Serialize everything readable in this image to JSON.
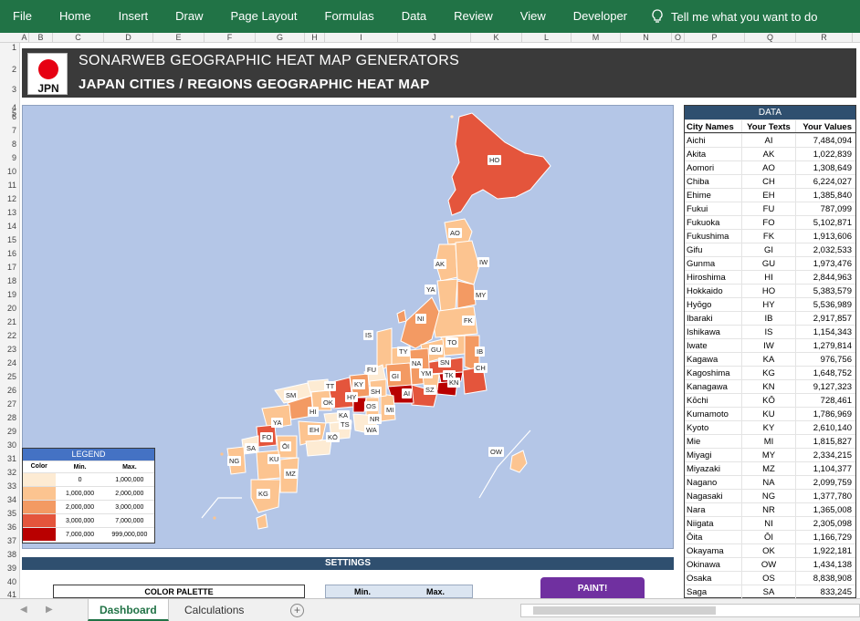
{
  "ribbon": {
    "tabs": [
      "File",
      "Home",
      "Insert",
      "Draw",
      "Page Layout",
      "Formulas",
      "Data",
      "Review",
      "View",
      "Developer"
    ],
    "tell_me": "Tell me what you want to do",
    "color": "#217346"
  },
  "columns": [
    "A",
    "B",
    "C",
    "D",
    "E",
    "F",
    "G",
    "H",
    "I",
    "J",
    "K",
    "L",
    "M",
    "N",
    "O",
    "P",
    "Q",
    "R"
  ],
  "rows": [
    "1",
    "2",
    "3",
    "4",
    "5",
    "6",
    "7",
    "8",
    "9",
    "10",
    "11",
    "12",
    "13",
    "14",
    "15",
    "16",
    "17",
    "18",
    "19",
    "20",
    "21",
    "22",
    "23",
    "24",
    "25",
    "26",
    "27",
    "28",
    "29",
    "30",
    "31",
    "32",
    "33",
    "34",
    "35",
    "36",
    "37",
    "38",
    "39",
    "40",
    "41"
  ],
  "header": {
    "logo_text": "JPN",
    "title": "SONARWEB GEOGRAPHIC HEAT MAP GENERATORS",
    "subtitle": "JAPAN CITIES / REGIONS GEOGRAPHIC HEAT MAP"
  },
  "map": {
    "labels": [
      "HO",
      "AO",
      "AK",
      "IW",
      "YA",
      "MY",
      "NI",
      "FK",
      "IS",
      "TO",
      "TY",
      "GU",
      "IB",
      "FU",
      "NA",
      "SN",
      "CH",
      "GI",
      "YM",
      "TK",
      "KY",
      "SH",
      "KN",
      "TT",
      "HY",
      "AI",
      "SZ",
      "SM",
      "OK",
      "OS",
      "MI",
      "HI",
      "KA",
      "NR",
      "TS",
      "WA",
      "YA",
      "EH",
      "KŌ",
      "FO",
      "ŌI",
      "SA",
      "KU",
      "NG",
      "MZ",
      "KG",
      "OW"
    ]
  },
  "legend": {
    "title": "LEGEND",
    "col_color": "Color",
    "col_min": "Min.",
    "col_max": "Max.",
    "rows": [
      {
        "color": "#fdebd3",
        "min": "0",
        "max": "1,000,000"
      },
      {
        "color": "#fcc490",
        "min": "1,000,000",
        "max": "2,000,000"
      },
      {
        "color": "#f39a63",
        "min": "2,000,000",
        "max": "3,000,000"
      },
      {
        "color": "#e4553c",
        "min": "3,000,000",
        "max": "7,000,000"
      },
      {
        "color": "#b90000",
        "min": "7,000,000",
        "max": "999,000,000"
      }
    ]
  },
  "data_table": {
    "title": "DATA",
    "headers": [
      "City Names",
      "Your Texts",
      "Your Values"
    ],
    "rows": [
      [
        "Aichi",
        "AI",
        "7,484,094"
      ],
      [
        "Akita",
        "AK",
        "1,022,839"
      ],
      [
        "Aomori",
        "AO",
        "1,308,649"
      ],
      [
        "Chiba",
        "CH",
        "6,224,027"
      ],
      [
        "Ehime",
        "EH",
        "1,385,840"
      ],
      [
        "Fukui",
        "FU",
        "787,099"
      ],
      [
        "Fukuoka",
        "FO",
        "5,102,871"
      ],
      [
        "Fukushima",
        "FK",
        "1,913,606"
      ],
      [
        "Gifu",
        "GI",
        "2,032,533"
      ],
      [
        "Gunma",
        "GU",
        "1,973,476"
      ],
      [
        "Hiroshima",
        "HI",
        "2,844,963"
      ],
      [
        "Hokkaido",
        "HO",
        "5,383,579"
      ],
      [
        "Hyōgo",
        "HY",
        "5,536,989"
      ],
      [
        "Ibaraki",
        "IB",
        "2,917,857"
      ],
      [
        "Ishikawa",
        "IS",
        "1,154,343"
      ],
      [
        "Iwate",
        "IW",
        "1,279,814"
      ],
      [
        "Kagawa",
        "KA",
        "976,756"
      ],
      [
        "Kagoshima",
        "KG",
        "1,648,752"
      ],
      [
        "Kanagawa",
        "KN",
        "9,127,323"
      ],
      [
        "Kōchi",
        "KŌ",
        "728,461"
      ],
      [
        "Kumamoto",
        "KU",
        "1,786,969"
      ],
      [
        "Kyoto",
        "KY",
        "2,610,140"
      ],
      [
        "Mie",
        "MI",
        "1,815,827"
      ],
      [
        "Miyagi",
        "MY",
        "2,334,215"
      ],
      [
        "Miyazaki",
        "MZ",
        "1,104,377"
      ],
      [
        "Nagano",
        "NA",
        "2,099,759"
      ],
      [
        "Nagasaki",
        "NG",
        "1,377,780"
      ],
      [
        "Nara",
        "NR",
        "1,365,008"
      ],
      [
        "Niigata",
        "NI",
        "2,305,098"
      ],
      [
        "Ōita",
        "ŌI",
        "1,166,729"
      ],
      [
        "Okayama",
        "OK",
        "1,922,181"
      ],
      [
        "Okinawa",
        "OW",
        "1,434,138"
      ],
      [
        "Osaka",
        "OS",
        "8,838,908"
      ],
      [
        "Saga",
        "SA",
        "833,245"
      ]
    ]
  },
  "settings": {
    "title": "SETTINGS",
    "palette": "COLOR PALETTE",
    "min": "Min.",
    "max": "Max.",
    "paint": "PAINT!"
  },
  "sheets": {
    "active": "Dashboard",
    "other": "Calculations"
  }
}
